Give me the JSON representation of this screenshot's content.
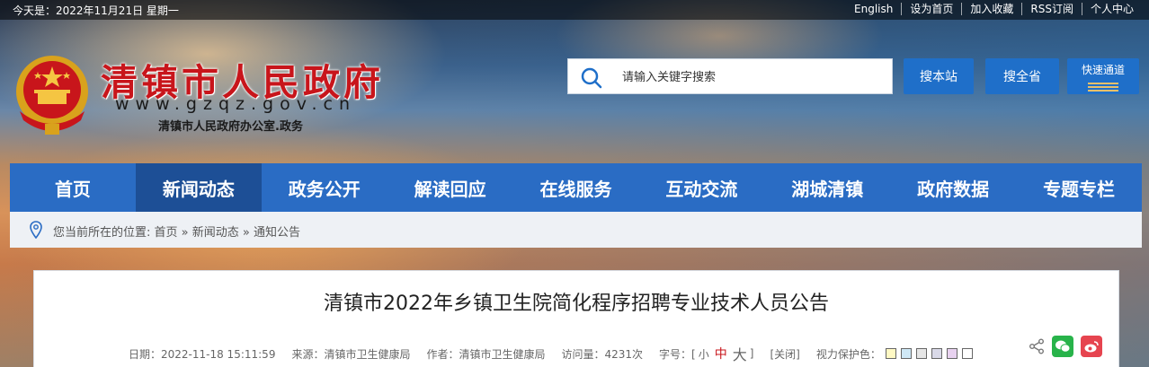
{
  "topbar": {
    "date": "今天是：2022年11月21日 星期一",
    "links": [
      "English",
      "设为首页",
      "加入收藏",
      "RSS订阅",
      "个人中心"
    ]
  },
  "header": {
    "title": "清镇市人民政府",
    "url": "www.gzqz.gov.cn",
    "subtitle": "清镇市人民政府办公室.政务",
    "title_color": "#c8151b"
  },
  "search": {
    "placeholder": "请输入关键字搜索",
    "btn_site": "搜本站",
    "btn_province": "搜全省",
    "btn_fast": "快速通道"
  },
  "nav": {
    "items": [
      "首页",
      "新闻动态",
      "政务公开",
      "解读回应",
      "在线服务",
      "互动交流",
      "湖城清镇",
      "政府数据",
      "专题专栏"
    ],
    "active_index": 1,
    "color": "#2a6cc4"
  },
  "breadcrumb": {
    "text": "您当前所在的位置: 首页 » 新闻动态 » 通知公告"
  },
  "article": {
    "title": "清镇市2022年乡镇卫生院简化程序招聘专业技术人员公告",
    "date": "日期：2022-11-18 15:11:59",
    "source": "来源：清镇市卫生健康局",
    "author": "作者：清镇市卫生健康局",
    "views": "访问量：4231次",
    "font_label": "字号：[",
    "font_small": "小",
    "font_mid": "中",
    "font_big": "大",
    "font_end": "]",
    "close": "[关闭]",
    "eye_label": "视力保护色：",
    "eye_colors": [
      "#fff9c4",
      "#cfe8f6",
      "#e6e6e6",
      "#d9d9e8",
      "#e8d2f0",
      "#ffffff"
    ]
  },
  "icons": [
    "share-icon",
    "wechat-icon",
    "weibo-icon",
    "search-icon",
    "location-pin-icon",
    "national-emblem-icon"
  ]
}
